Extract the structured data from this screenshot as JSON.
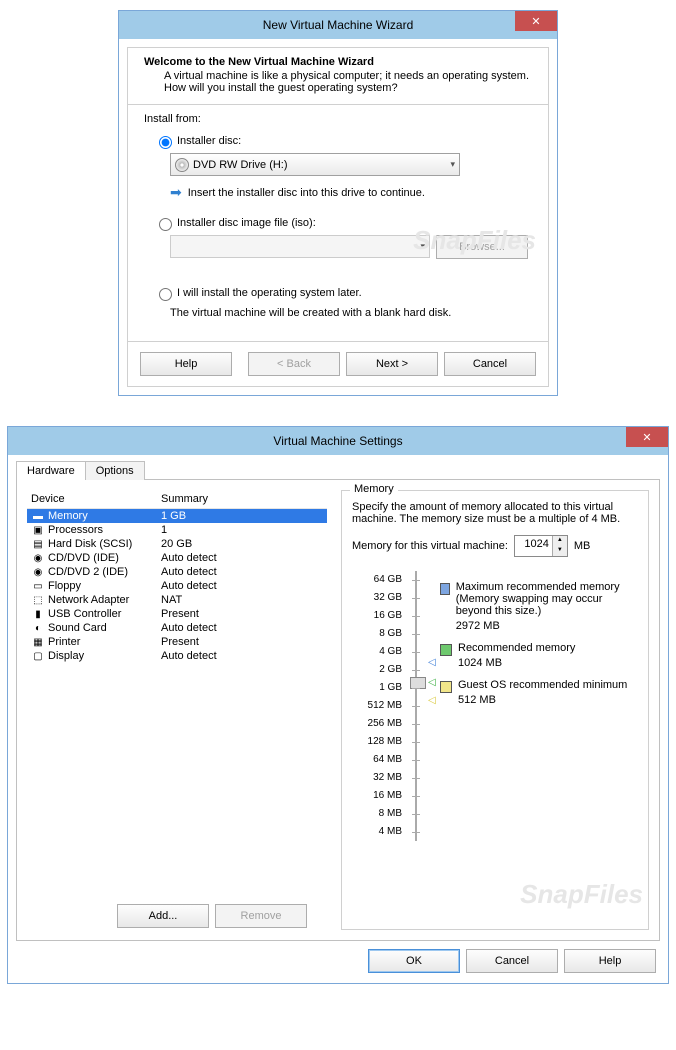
{
  "wizard": {
    "title": "New Virtual Machine Wizard",
    "header_title": "Welcome to the New Virtual Machine Wizard",
    "header_desc": "A virtual machine is like a physical computer; it needs an operating system. How will you install the guest operating system?",
    "install_from": "Install from:",
    "opt_disc": "Installer disc:",
    "disc_value": "DVD RW Drive (H:)",
    "disc_hint": "Insert the installer disc into this drive to continue.",
    "opt_iso": "Installer disc image file (iso):",
    "browse": "Browse...",
    "opt_later": "I will install the operating system later.",
    "later_note": "The virtual machine will be created with a blank hard disk.",
    "help": "Help",
    "back": "< Back",
    "next": "Next >",
    "cancel": "Cancel"
  },
  "settings": {
    "title": "Virtual Machine Settings",
    "tab_hardware": "Hardware",
    "tab_options": "Options",
    "col_device": "Device",
    "col_summary": "Summary",
    "devices": [
      {
        "name": "Memory",
        "summary": "1 GB",
        "selected": true,
        "icon": "▬"
      },
      {
        "name": "Processors",
        "summary": "1",
        "icon": "▣"
      },
      {
        "name": "Hard Disk (SCSI)",
        "summary": "20 GB",
        "icon": "▤"
      },
      {
        "name": "CD/DVD (IDE)",
        "summary": "Auto detect",
        "icon": "◉"
      },
      {
        "name": "CD/DVD 2 (IDE)",
        "summary": "Auto detect",
        "icon": "◉"
      },
      {
        "name": "Floppy",
        "summary": "Auto detect",
        "icon": "▭"
      },
      {
        "name": "Network Adapter",
        "summary": "NAT",
        "icon": "⬚"
      },
      {
        "name": "USB Controller",
        "summary": "Present",
        "icon": "▮"
      },
      {
        "name": "Sound Card",
        "summary": "Auto detect",
        "icon": "◐"
      },
      {
        "name": "Printer",
        "summary": "Present",
        "icon": "▦"
      },
      {
        "name": "Display",
        "summary": "Auto detect",
        "icon": "▢"
      }
    ],
    "add": "Add...",
    "remove": "Remove",
    "memory": {
      "legend": "Memory",
      "desc": "Specify the amount of memory allocated to this virtual machine. The memory size must be a multiple of 4 MB.",
      "label": "Memory for this virtual machine:",
      "value": "1024",
      "unit": "MB",
      "ticks": [
        "64 GB",
        "32 GB",
        "16 GB",
        "8 GB",
        "4 GB",
        "2 GB",
        "1 GB",
        "512 MB",
        "256 MB",
        "128 MB",
        "64 MB",
        "32 MB",
        "16 MB",
        "8 MB",
        "4 MB"
      ],
      "max_label": "Maximum recommended memory",
      "max_note": "(Memory swapping may occur beyond this size.)",
      "max_val": "2972 MB",
      "rec_label": "Recommended memory",
      "rec_val": "1024 MB",
      "min_label": "Guest OS recommended minimum",
      "min_val": "512 MB"
    },
    "ok": "OK",
    "cancel": "Cancel",
    "help": "Help"
  },
  "watermark": "SnapFiles"
}
